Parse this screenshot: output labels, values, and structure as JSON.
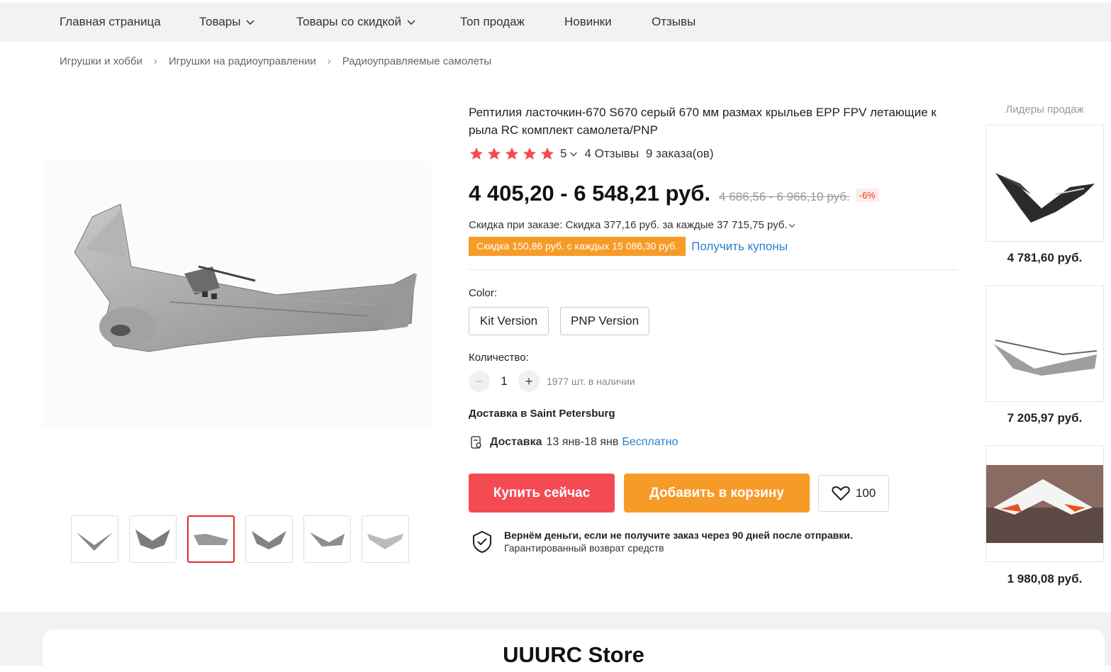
{
  "nav": {
    "items": [
      {
        "label": "Главная страница"
      },
      {
        "label": "Товары"
      },
      {
        "label": "Товары со скидкой"
      },
      {
        "label": "Топ продаж"
      },
      {
        "label": "Новинки"
      },
      {
        "label": "Отзывы"
      }
    ]
  },
  "breadcrumb": [
    "Игрушки и хобби",
    "Игрушки на радиоуправлении",
    "Радиоуправляемые самолеты"
  ],
  "product": {
    "title": "Рептилия ласточкин-670 S670 серый 670 мм размах крыльев EPP FPV летающие к рыла RC комплект самолета/PNP",
    "rating": "5",
    "reviews": "4 Отзывы",
    "orders": "9 заказа(ов)",
    "price": "4 405,20 - 6 548,21 руб.",
    "old_price": "4 686,56 - 6 966,10 руб.",
    "discount_pct": "-6%",
    "order_discount": "Скидка при заказе: Скидка 377,16 руб. за каждые 37 715,75 руб.",
    "coupon_tag": "Скидка 150,86 руб. с каждых 15 086,30 руб.",
    "coupon_link": "Получить купоны",
    "color_label": "Color:",
    "colors": [
      "Kit Version",
      "PNP Version"
    ],
    "qty_label": "Количество:",
    "qty": "1",
    "stock": "1977 шт. в наличии",
    "ship_to": "Доставка в Saint Petersburg",
    "ship_label": "Доставка",
    "ship_dates": "13 янв-18 янв",
    "ship_price": "Бесплатно",
    "buy_now": "Купить сейчас",
    "add_cart": "Добавить в корзину",
    "wish_count": "100",
    "guarantee_title": "Вернём деньги, если не получите заказ через 90 дней после отправки.",
    "guarantee_sub": "Гарантированный возврат средств"
  },
  "sidebar": {
    "title": "Лидеры продаж",
    "items": [
      {
        "price": "4 781,60 руб."
      },
      {
        "price": "7 205,97 руб."
      },
      {
        "price": "1 980,08 руб."
      }
    ]
  },
  "store": {
    "name": "UUURC Store"
  },
  "colors": {
    "buy": "#f44a53",
    "cart": "#f79b28",
    "link": "#2a7fd4",
    "star": "#f44a53"
  }
}
